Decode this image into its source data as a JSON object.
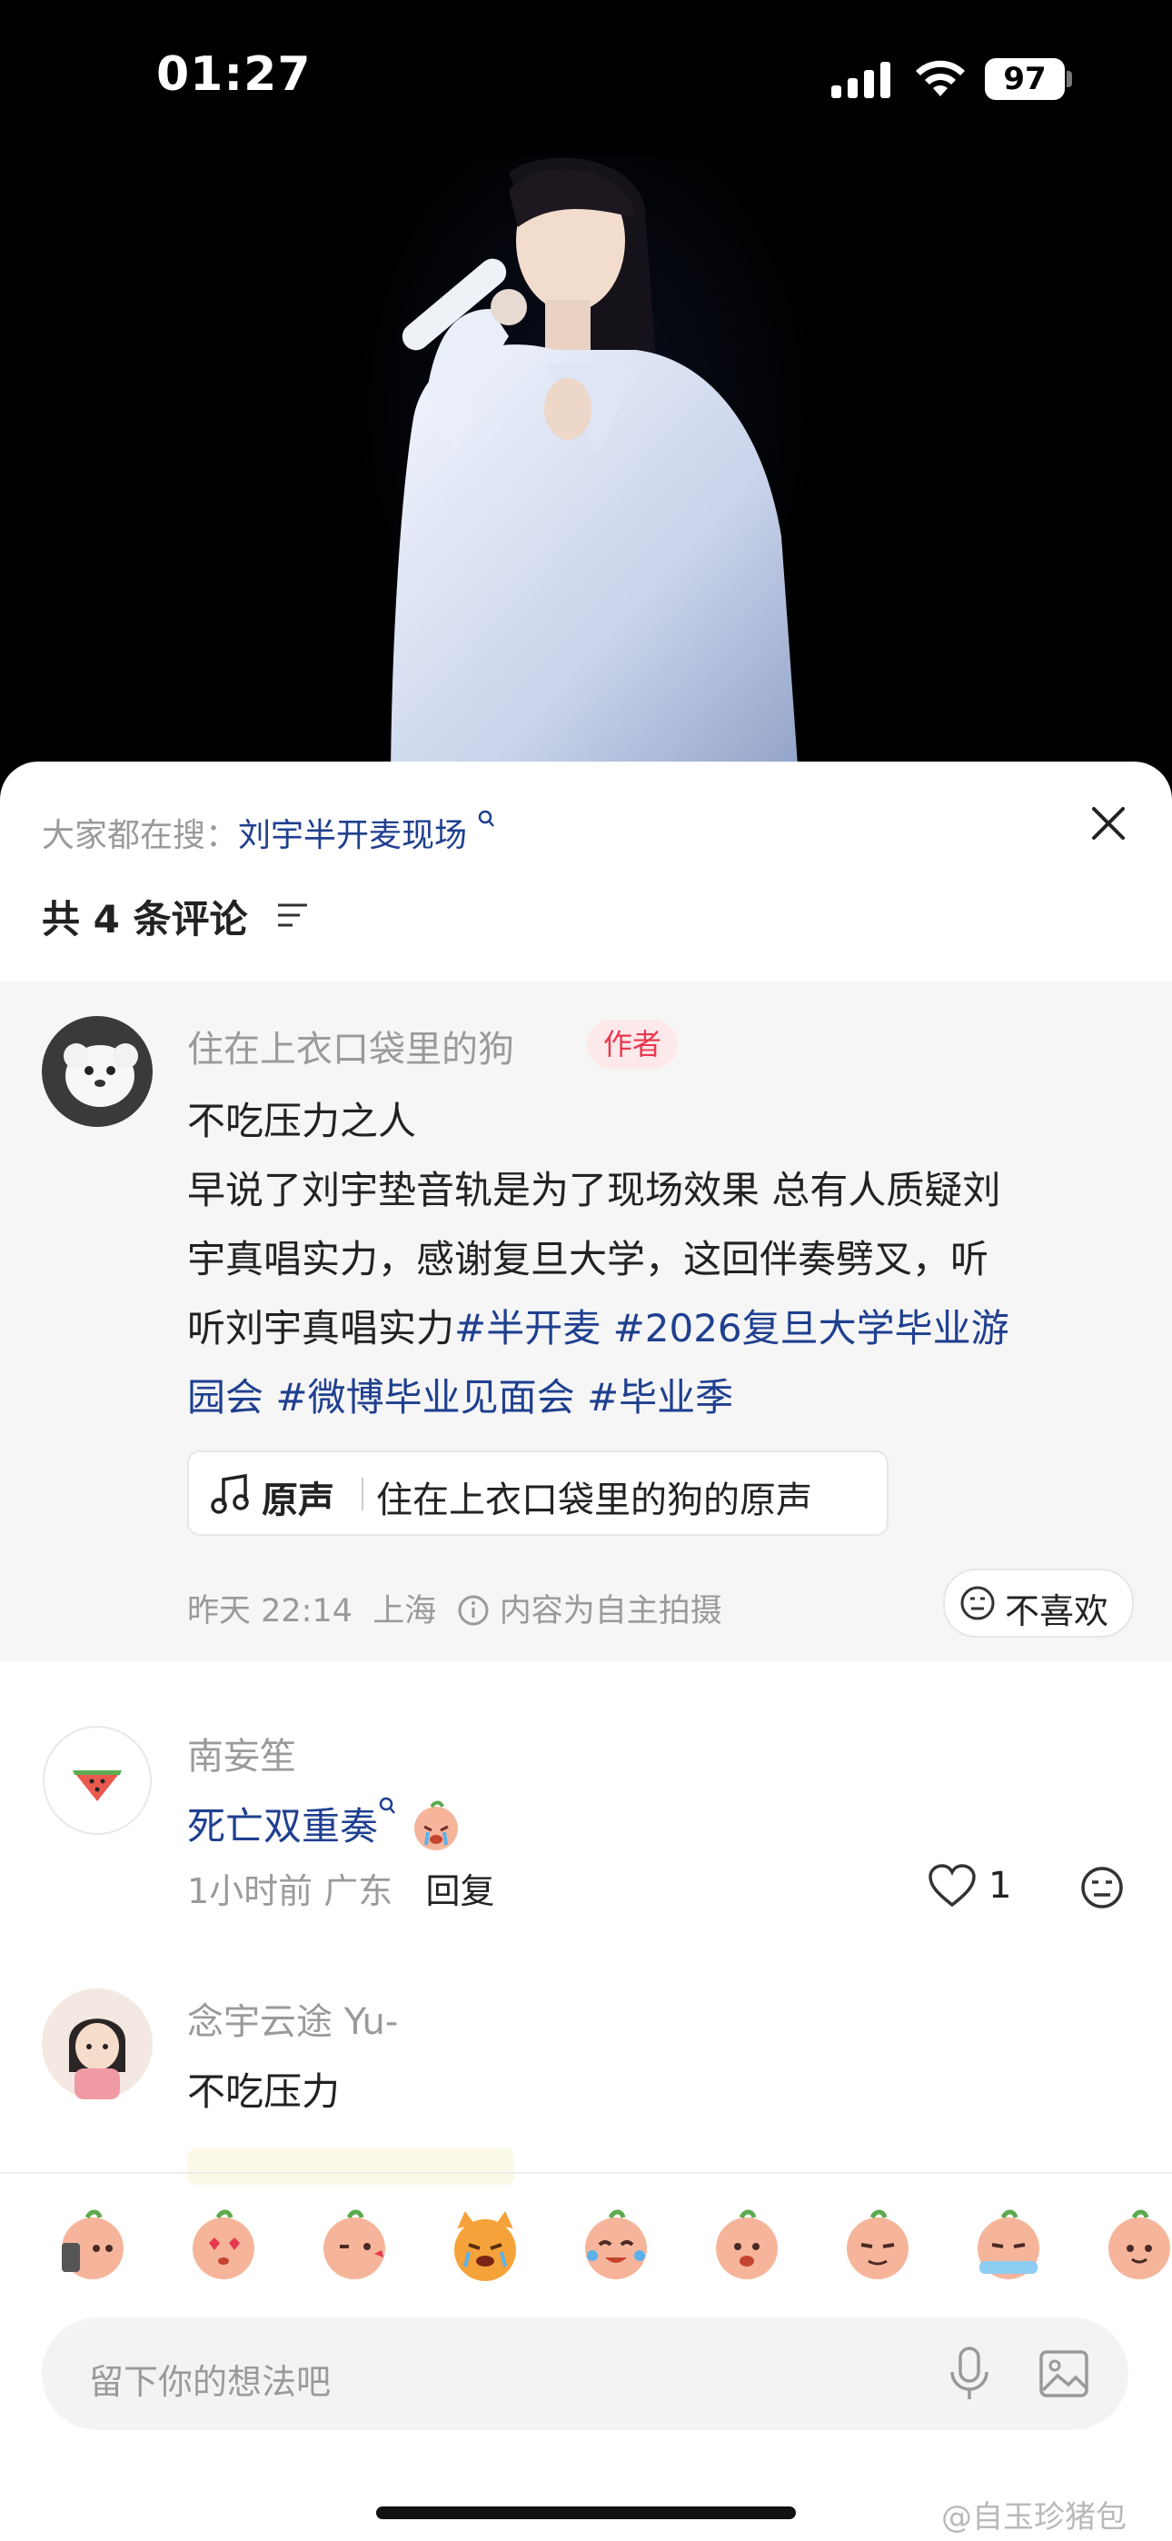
{
  "status_bar": {
    "time": "01:27",
    "battery": "97"
  },
  "search_suggestion": {
    "prefix": "大家都在搜：",
    "query": "刘宇半开麦现场"
  },
  "comments_header": {
    "count_label": "共 4 条评论"
  },
  "post": {
    "author": "住在上衣口袋里的狗",
    "author_badge": "作者",
    "title": "不吃压力之人",
    "body_lines": [
      "早说了刘宇垫音轨是为了现场效果 总有人质疑刘",
      "宇真唱实力，感谢复旦大学，这回伴奏劈叉，听"
    ],
    "line3_text": "听刘宇真唱实力",
    "hashtags": [
      "#半开麦",
      "#2026复旦大学毕业游",
      "园会",
      "#微博毕业见面会",
      "#毕业季"
    ],
    "sound_label": "原声",
    "sound_title": "住在上衣口袋里的狗的原声",
    "time": "昨天 22:14",
    "location": "上海",
    "notice": "内容为自主拍摄",
    "dislike_label": "不喜欢"
  },
  "comments": [
    {
      "user": "南妄笙",
      "text": "死亡双重奏",
      "time": "1小时前",
      "location": "广东",
      "reply_label": "回复",
      "likes": "1"
    },
    {
      "user": "念宇云途 Yu-",
      "text": "不吃压力"
    }
  ],
  "input": {
    "placeholder": "留下你的想法吧"
  },
  "watermark": "@自玉珍猪包",
  "colors": {
    "link_blue": "#1f3f8f",
    "badge_red": "#e8384f",
    "badge_bg": "#fde8ea",
    "avatar_bg": "#f3f3f3"
  },
  "emoji_icons": [
    "peach-phone-emoji",
    "peach-heart-eyes-emoji",
    "peach-wink-emoji",
    "cat-crying-emoji",
    "peach-laugh-cry-emoji",
    "peach-shy-emoji",
    "peach-smug-emoji",
    "peach-sobbing-emoji",
    "peach-smile-emoji"
  ]
}
